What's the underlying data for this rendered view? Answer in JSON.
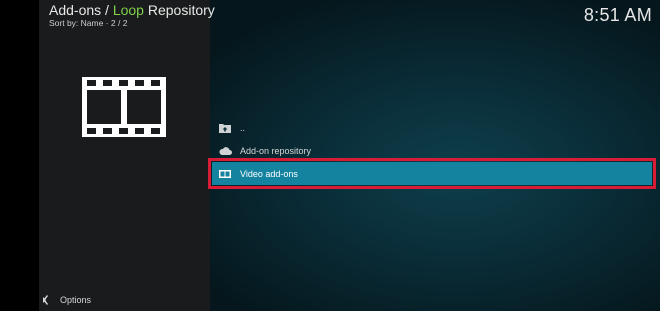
{
  "header": {
    "breadcrumb_prefix": "Add-ons / ",
    "breadcrumb_accent": "Loop",
    "breadcrumb_suffix": " Repository",
    "sort_info": "Sort by: Name  ·  2 / 2"
  },
  "clock": {
    "time": "8:51 AM"
  },
  "colors": {
    "accent": "#7fd14a",
    "selection": "#13839f",
    "highlight_border": "#d81c38"
  },
  "list": {
    "items": [
      {
        "label": "..",
        "icon": "folder-up-icon"
      },
      {
        "label": "Add-on repository",
        "icon": "cloud-icon"
      },
      {
        "label": "Video add-ons",
        "icon": "film-icon",
        "selected": true
      }
    ]
  },
  "footer": {
    "options_label": "Options",
    "options_icon": "options-icon"
  }
}
